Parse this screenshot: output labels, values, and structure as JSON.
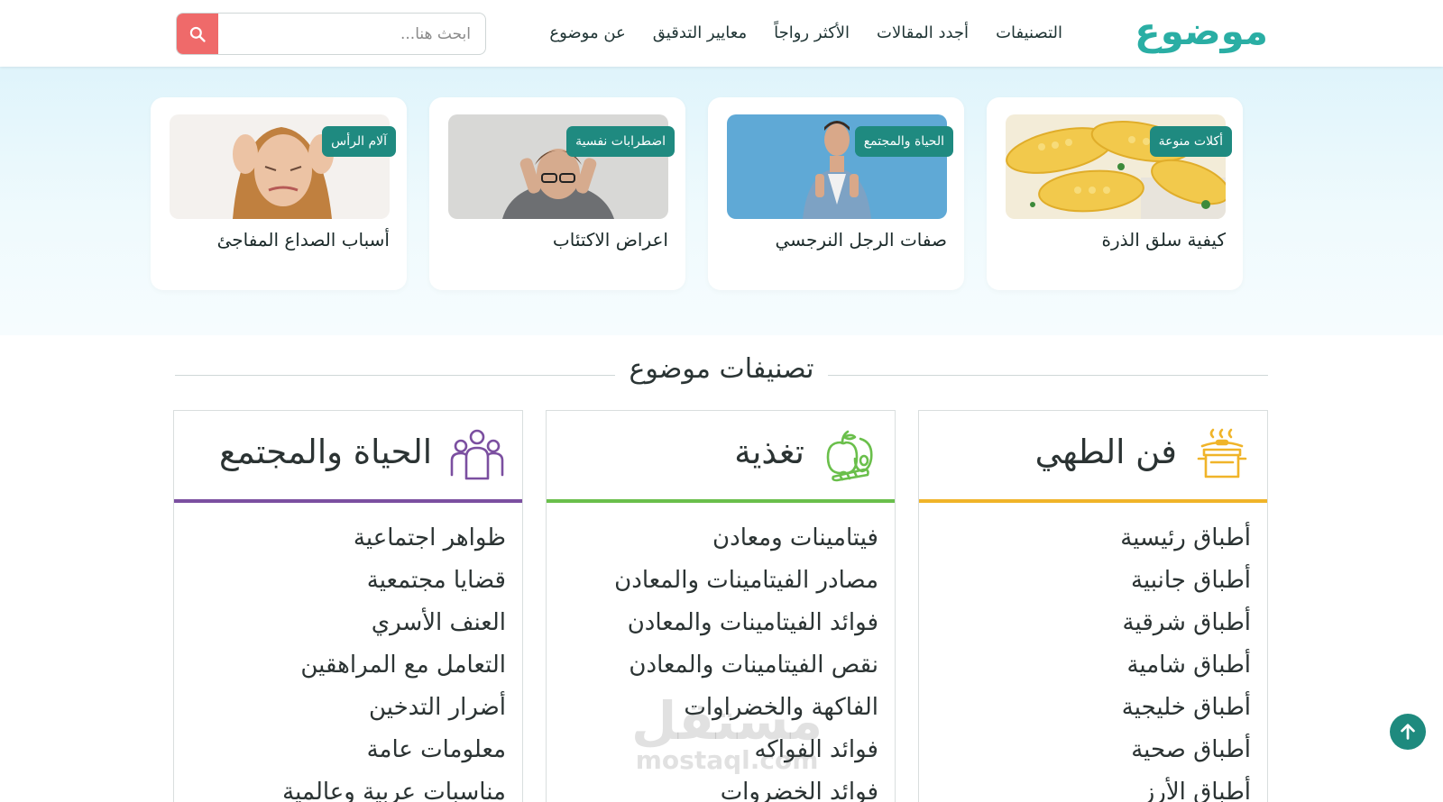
{
  "header": {
    "logo": "موضوع",
    "nav": [
      "التصنيفات",
      "أجدد المقالات",
      "الأكثر رواجاً",
      "معايير التدقيق",
      "عن موضوع"
    ],
    "search_placeholder": "ابحث هنا...",
    "search_icon": "search-icon"
  },
  "featured": [
    {
      "tag": "أكلات منوعة",
      "title": "كيفية سلق الذرة",
      "image": "corn-photo"
    },
    {
      "tag": "الحياة والمجتمع",
      "title": "صفات الرجل النرجسي",
      "image": "man-photo"
    },
    {
      "tag": "اضطرابات نفسية",
      "title": "اعراض الاكتئاب",
      "image": "depressed-man-photo"
    },
    {
      "tag": "آلام الرأس",
      "title": "أسباب الصداع المفاجئ",
      "image": "headache-woman-photo"
    }
  ],
  "categories_title": "تصنيفات موضوع",
  "categories": [
    {
      "title": "فن الطهي",
      "icon": "cooking-pot-icon",
      "accent": "#f0b429",
      "items": [
        "أطباق رئيسية",
        "أطباق جانبية",
        "أطباق شرقية",
        "أطباق شامية",
        "أطباق خليجية",
        "أطباق صحية",
        "أطباق الأرز"
      ]
    },
    {
      "title": "تغذية",
      "icon": "fruits-vegetables-icon",
      "accent": "#6abf4b",
      "items": [
        "فيتامينات ومعادن",
        "مصادر الفيتامينات والمعادن",
        "فوائد الفيتامينات والمعادن",
        "نقص الفيتامينات والمعادن",
        "الفاكهة والخضراوات",
        "فوائد الفواكه",
        "فوائد الخضروات"
      ]
    },
    {
      "title": "الحياة والمجتمع",
      "icon": "people-group-icon",
      "accent": "#7b4fa0",
      "items": [
        "ظواهر اجتماعية",
        "قضايا مجتمعية",
        "العنف الأسري",
        "التعامل مع المراهقين",
        "أضرار التدخين",
        "معلومات عامة",
        "مناسبات عربية وعالمية"
      ]
    }
  ],
  "watermark": {
    "ar": "مستقل",
    "en": "mostaql.com"
  },
  "colors": {
    "brand": "#2aaea4",
    "tag_bg": "#1f8a80",
    "search_btn": "#ef6a6a",
    "scroll_top": "#1e8a7e"
  },
  "scroll_top_icon": "arrow-up-icon"
}
